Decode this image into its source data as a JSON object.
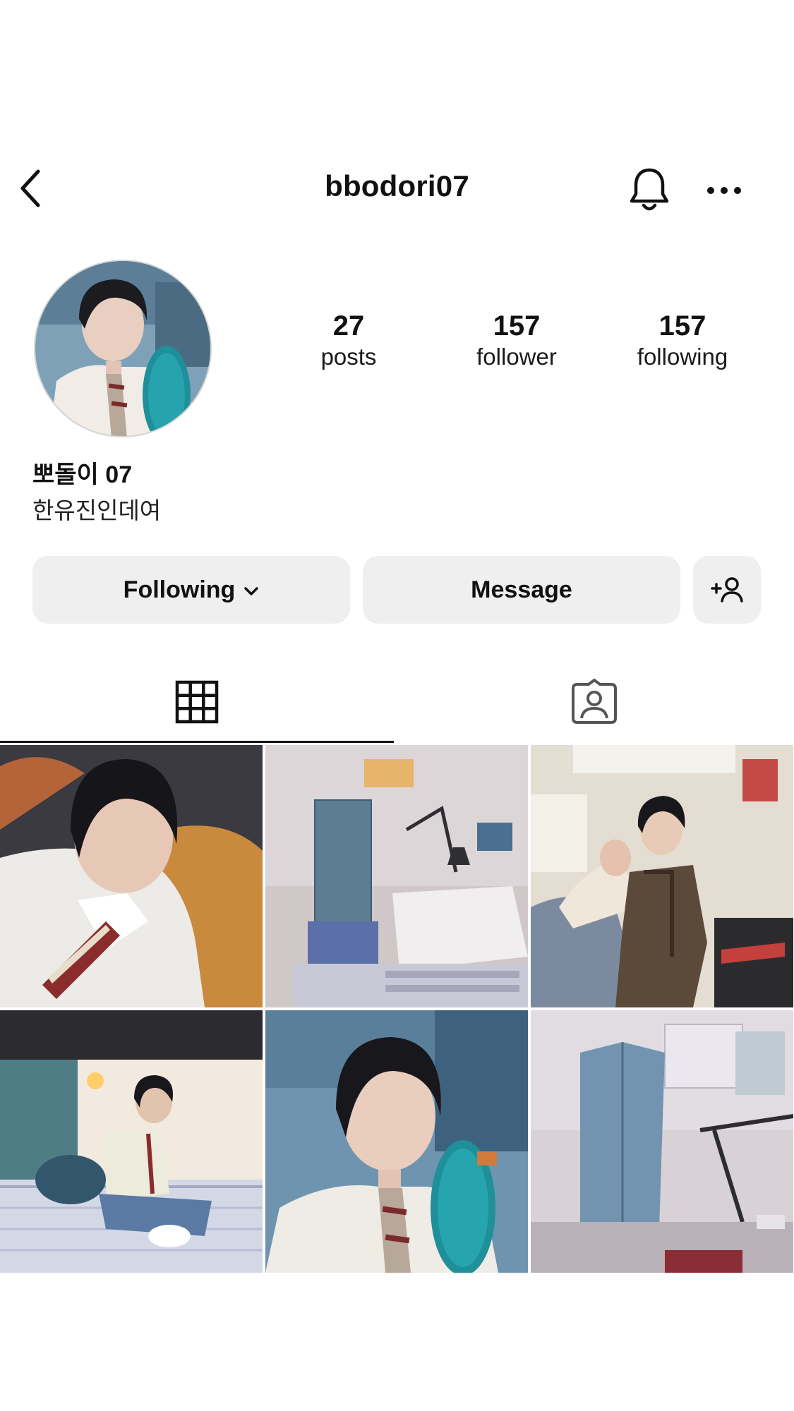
{
  "header": {
    "username": "bbodori07",
    "back_icon": "chevron-left-icon",
    "notification_icon": "bell-icon",
    "more_icon": "more-horizontal-icon"
  },
  "profile": {
    "display_name": "뽀돌이 07",
    "bio": "한유진인데여",
    "stats": {
      "posts": {
        "count": "27",
        "label": "posts"
      },
      "followers": {
        "count": "157",
        "label": "follower"
      },
      "following": {
        "count": "157",
        "label": "following"
      }
    }
  },
  "actions": {
    "following_label": "Following",
    "message_label": "Message",
    "add_user_icon": "add-person-icon"
  },
  "tabs": [
    {
      "icon": "grid-icon",
      "active": true
    },
    {
      "icon": "tagged-person-icon",
      "active": false
    }
  ],
  "posts": [
    {
      "subject": "portrait-on-orange-sofa"
    },
    {
      "subject": "drafting-desk-with-lamp"
    },
    {
      "subject": "two-people-sleeping-against-wall"
    },
    {
      "subject": "sitting-on-bunk-bed"
    },
    {
      "subject": "portrait-with-skateboard"
    },
    {
      "subject": "building-model-on-desk"
    }
  ],
  "colors": {
    "button_bg": "#efefef",
    "text": "#111111",
    "divider": "#111111"
  }
}
